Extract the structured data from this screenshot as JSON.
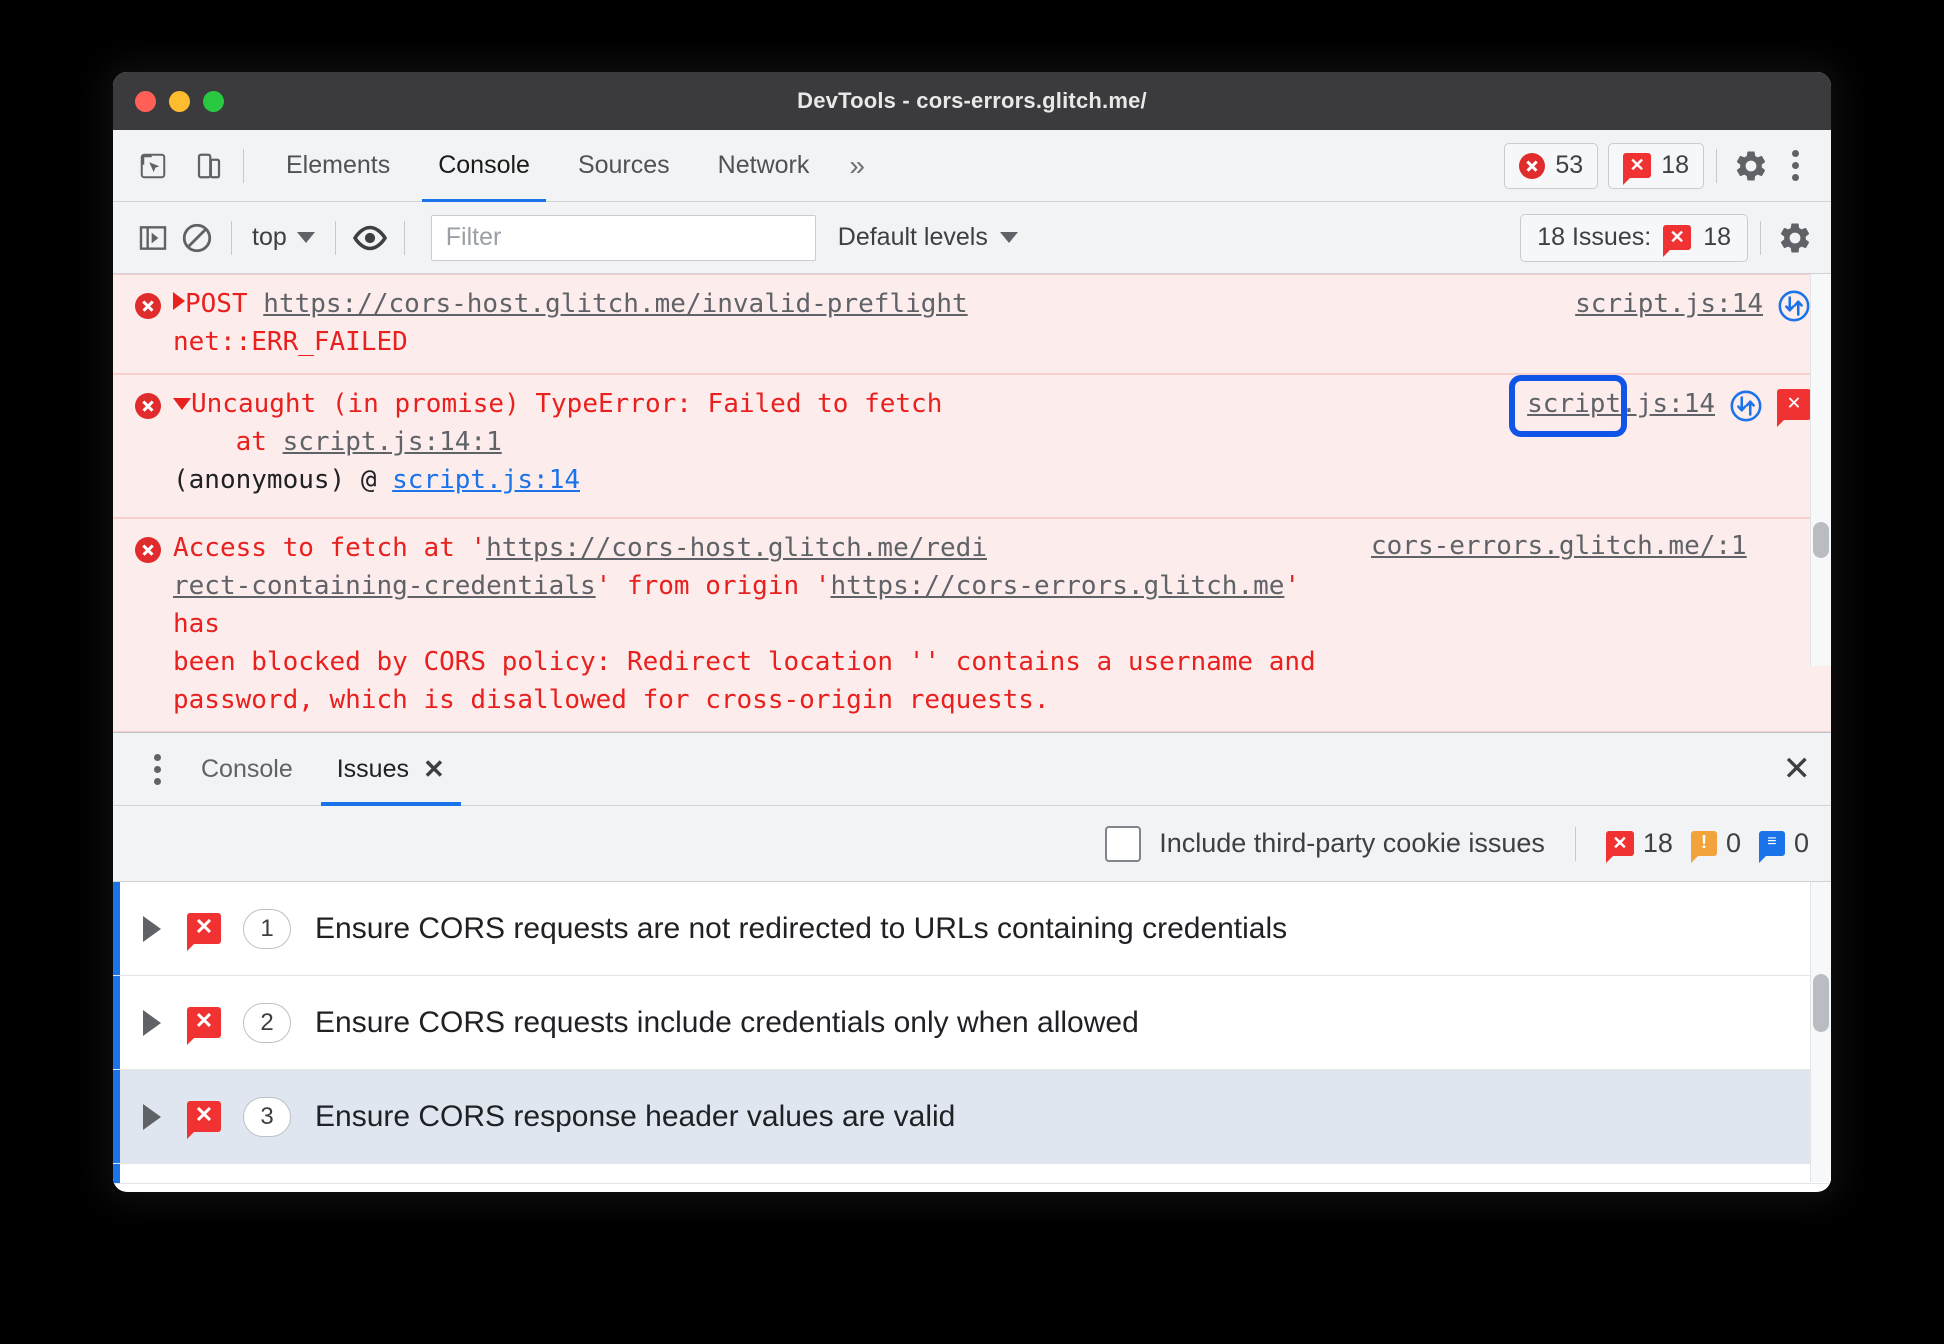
{
  "window": {
    "title": "DevTools - cors-errors.glitch.me/"
  },
  "main_toolbar": {
    "inspect_icon": "inspect-cursor-icon",
    "device_icon": "device-toolbar-icon",
    "tabs": [
      {
        "label": "Elements",
        "active": false
      },
      {
        "label": "Console",
        "active": true
      },
      {
        "label": "Sources",
        "active": false
      },
      {
        "label": "Network",
        "active": false
      }
    ],
    "more_tabs": "»",
    "error_count": "53",
    "issue_count": "18",
    "settings_icon": "gear-icon",
    "menu_icon": "kebab-menu-icon"
  },
  "console_toolbar": {
    "sidebar_toggle_icon": "console-sidebar-icon",
    "clear_icon": "clear-console-icon",
    "context": "top",
    "eye_icon": "live-expression-eye-icon",
    "filter_placeholder": "Filter",
    "filter_value": "",
    "levels": "Default levels",
    "issues_button_label": "18 Issues:",
    "issues_button_count": "18",
    "settings_icon": "gear-icon"
  },
  "console_messages": [
    {
      "icon": "error-circle-icon",
      "disclosure": "collapsed",
      "text_parts": [
        {
          "t": "POST ",
          "style": "error"
        },
        {
          "t": "https://cors-host.glitch.me/invalid-preflight",
          "style": "link"
        },
        {
          "t": "\nnet::ERR_FAILED",
          "style": "error"
        }
      ],
      "plain": "POST https://cors-host.glitch.me/invalid-preflight net::ERR_FAILED",
      "source": "script.js:14",
      "right_icons": [
        "network-request-icon"
      ],
      "highlighted": false
    },
    {
      "icon": "error-circle-icon",
      "disclosure": "expanded",
      "plain": "Uncaught (in promise) TypeError: Failed to fetch",
      "stack_at": "    at ",
      "stack_link": "script.js:14:1",
      "anon_text": "(anonymous) @ ",
      "anon_link": "script.js:14",
      "source": "script.js:14",
      "right_icons": [
        "network-request-icon",
        "issue-bubble-icon"
      ],
      "highlighted": true
    },
    {
      "icon": "error-circle-icon",
      "plain": "Access to fetch at 'https://cors-host.glitch.me/redirect-containing-credentials' from origin 'https://cors-errors.glitch.me' has been blocked by CORS policy: Redirect location '' contains a username and password, which is disallowed for cross-origin requests.",
      "seg1": "Access to fetch at '",
      "url1": "https://cors-host.glitch.me/redi",
      "url1b": "rect-containing-credentials",
      "seg2": "' from origin '",
      "url2": "https://cors-errors.glitch.me",
      "seg3": "' has",
      "seg4": "been blocked by CORS policy: Redirect location '' contains a username and",
      "seg5": "password, which is disallowed for cross-origin requests.",
      "source": "cors-errors.glitch.me/:1",
      "highlighted": false
    }
  ],
  "drawer": {
    "menu_icon": "kebab-menu-icon",
    "tabs": [
      {
        "label": "Console",
        "active": false,
        "closable": false
      },
      {
        "label": "Issues",
        "active": true,
        "closable": true
      }
    ],
    "close_icon": "close-icon",
    "close_label": "✕",
    "filter": {
      "checkbox_label": "Include third-party cookie issues",
      "checked": false,
      "error_count": "18",
      "warning_count": "0",
      "info_count": "0"
    },
    "issues": [
      {
        "count": "1",
        "title": "Ensure CORS requests are not redirected to URLs containing credentials",
        "selected": false
      },
      {
        "count": "2",
        "title": "Ensure CORS requests include credentials only when allowed",
        "selected": false
      },
      {
        "count": "3",
        "title": "Ensure CORS response header values are valid",
        "selected": true
      }
    ]
  },
  "colors": {
    "accent": "#1a73e8",
    "error_red": "#e8201e",
    "error_bg": "#fdecec",
    "badge_red": "#f03232",
    "highlight_blue": "#1155e8",
    "selected_row": "#dfe6ef"
  }
}
